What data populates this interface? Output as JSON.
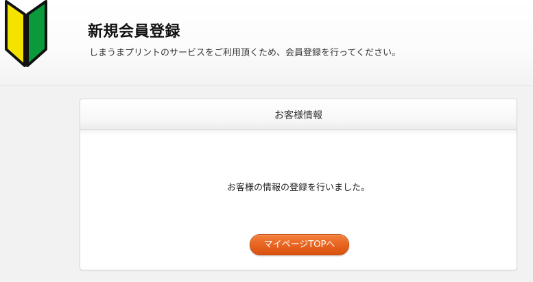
{
  "header": {
    "title": "新規会員登録",
    "description": "しまうまプリントのサービスをご利用頂くため、会員登録を行ってください。",
    "logo_icon": "beginner-mark-icon"
  },
  "panel": {
    "title": "お客様情報",
    "message": "お客様の情報の登録を行いました。",
    "button_label": "マイページTOPへ"
  },
  "colors": {
    "accent_button": "#e8621f",
    "mark_yellow": "#f4e300",
    "mark_green": "#0a9a3c"
  }
}
